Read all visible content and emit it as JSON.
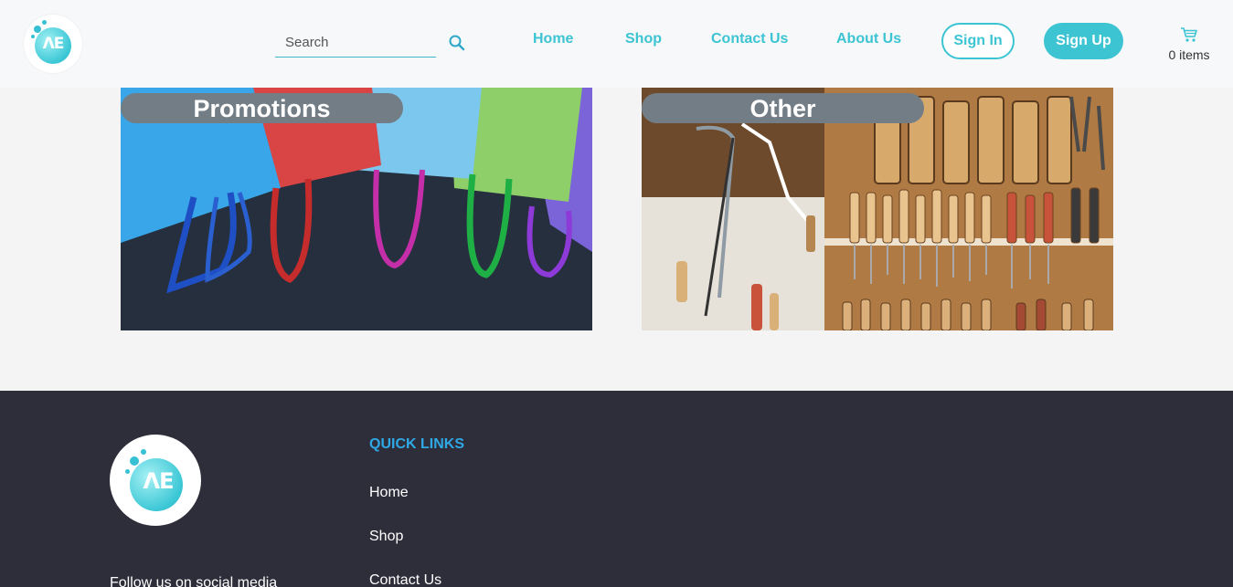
{
  "header": {
    "logo_text": "ΛE",
    "search": {
      "placeholder": "Search",
      "value": ""
    },
    "nav": [
      "Home",
      "Shop",
      "Contact Us",
      "About Us"
    ],
    "sign_in": "Sign In",
    "sign_up": "Sign Up",
    "cart_count": "0 items",
    "accent_color": "#3cc4d3"
  },
  "categories": [
    {
      "label": "Promotions",
      "image": "colorful shopping bags"
    },
    {
      "label": "Other",
      "image": "workshop tools on wall"
    }
  ],
  "footer": {
    "logo_text": "ΛE",
    "follow_text": "Follow us on social media",
    "quick_links_title": "QUICK LINKS",
    "quick_links": [
      "Home",
      "Shop",
      "Contact Us"
    ]
  },
  "icons": [
    "search-icon",
    "cart-icon"
  ]
}
